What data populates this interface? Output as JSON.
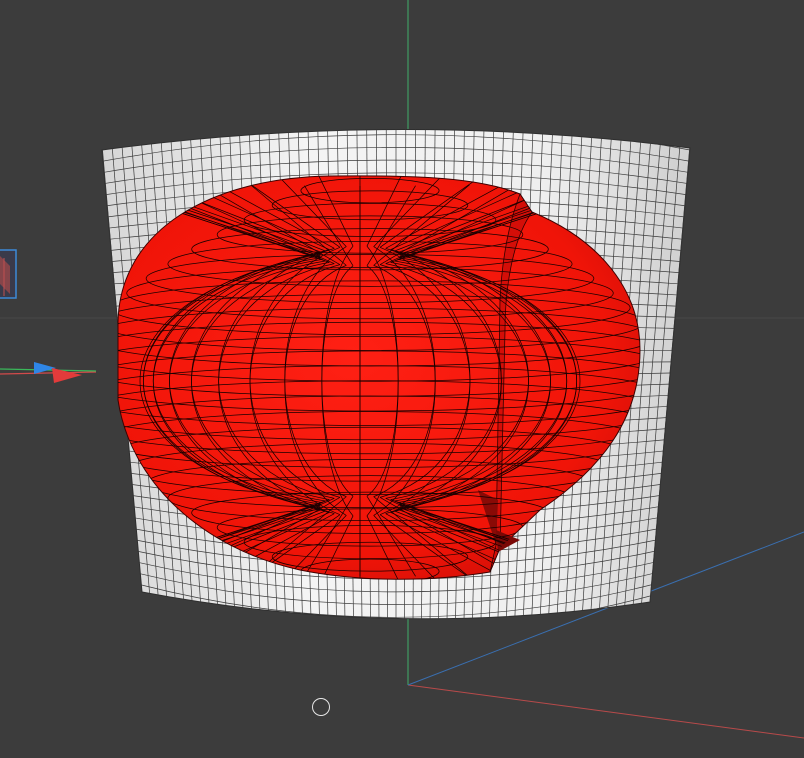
{
  "viewport": {
    "background_color": "#3c3c3c",
    "grid_line_color": "#4a4a4a"
  },
  "axes": {
    "y_axis_color": "#3fae6a",
    "x_axis_color": "#c05050",
    "z_axis_color": "#3a6fb0"
  },
  "mesh": {
    "outer_shell_color": "#ededed",
    "outer_shell_wire_color": "#3a3a3a",
    "inner_blob_color": "#ff1a10",
    "inner_blob_shade_color": "#c80c08",
    "inner_blob_wire_color": "#1a0000"
  },
  "gizmo": {
    "x_handle_color": "#e23b3b",
    "z_handle_color": "#2f86e6",
    "y_handle_color": "#38c058"
  },
  "icons": {
    "pivot": "circle-outline-icon",
    "view_cube_fragment": "view-cube-icon"
  }
}
